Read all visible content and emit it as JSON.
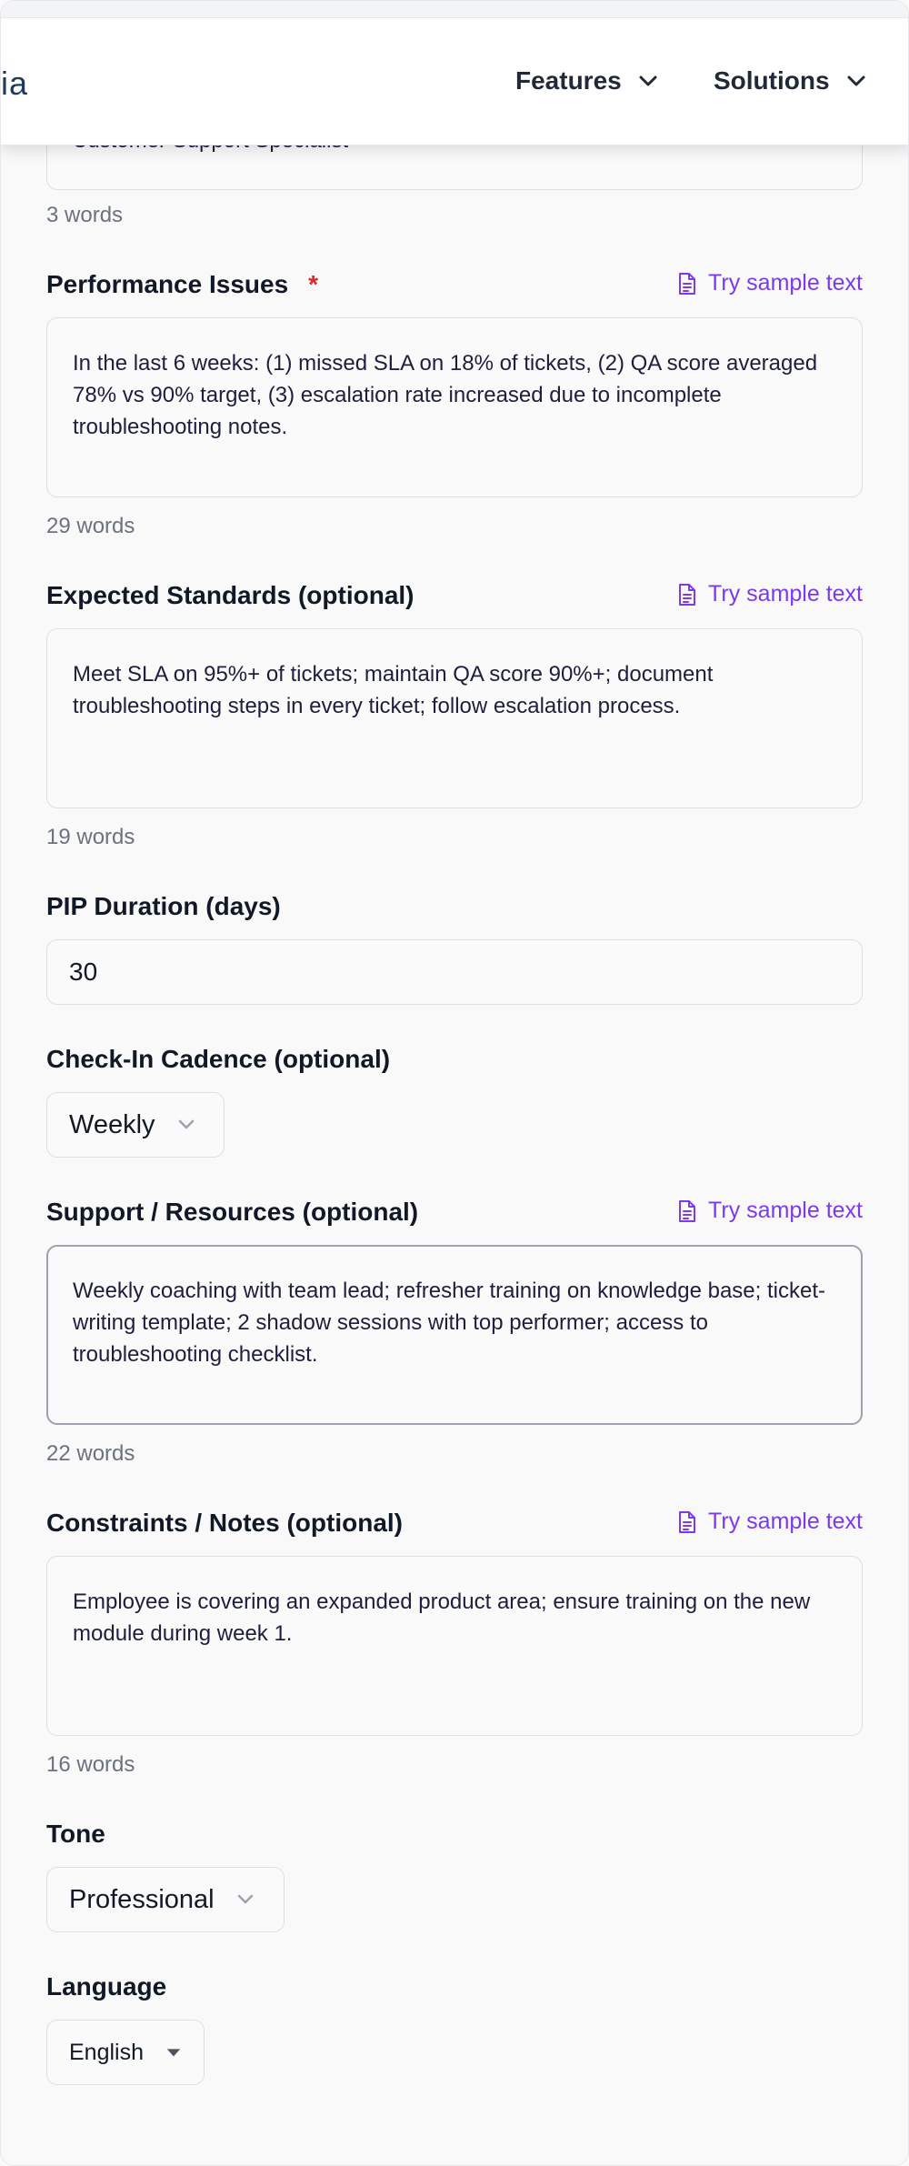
{
  "header": {
    "brand_partial": "ia",
    "nav": [
      {
        "label": "Features"
      },
      {
        "label": "Solutions"
      }
    ]
  },
  "form": {
    "job_title": {
      "value_partial": "Customer Support Specialist",
      "word_count": "3 words"
    },
    "performance_issues": {
      "label": "Performance Issues",
      "required_mark": "*",
      "sample_link": "Try sample text",
      "value": "In the last 6 weeks: (1) missed SLA on 18% of tickets, (2) QA score averaged 78% vs 90% target, (3) escalation rate increased due to incomplete troubleshooting notes.",
      "word_count": "29 words"
    },
    "expected_standards": {
      "label": "Expected Standards (optional)",
      "sample_link": "Try sample text",
      "value": "Meet SLA on 95%+ of tickets; maintain QA score 90%+; document troubleshooting steps in every ticket; follow escalation process.",
      "word_count": "19 words"
    },
    "pip_duration": {
      "label": "PIP Duration (days)",
      "value": "30"
    },
    "check_in_cadence": {
      "label": "Check-In Cadence (optional)",
      "selected": "Weekly"
    },
    "support_resources": {
      "label": "Support / Resources (optional)",
      "sample_link": "Try sample text",
      "value": "Weekly coaching with team lead; refresher training on knowledge base; ticket-writing template; 2 shadow sessions with top performer; access to troubleshooting checklist.",
      "word_count": "22 words"
    },
    "constraints_notes": {
      "label": "Constraints / Notes (optional)",
      "sample_link": "Try sample text",
      "value": "Employee is covering an expanded product area; ensure training on the new module during week 1.",
      "word_count": "16 words"
    },
    "tone": {
      "label": "Tone",
      "selected": "Professional"
    },
    "language": {
      "label": "Language",
      "selected": "English"
    }
  },
  "colors": {
    "accent": "#7c3aed",
    "required": "#dc2626",
    "text": "#111827",
    "muted": "#6b7280",
    "border": "#dcdfe4"
  }
}
